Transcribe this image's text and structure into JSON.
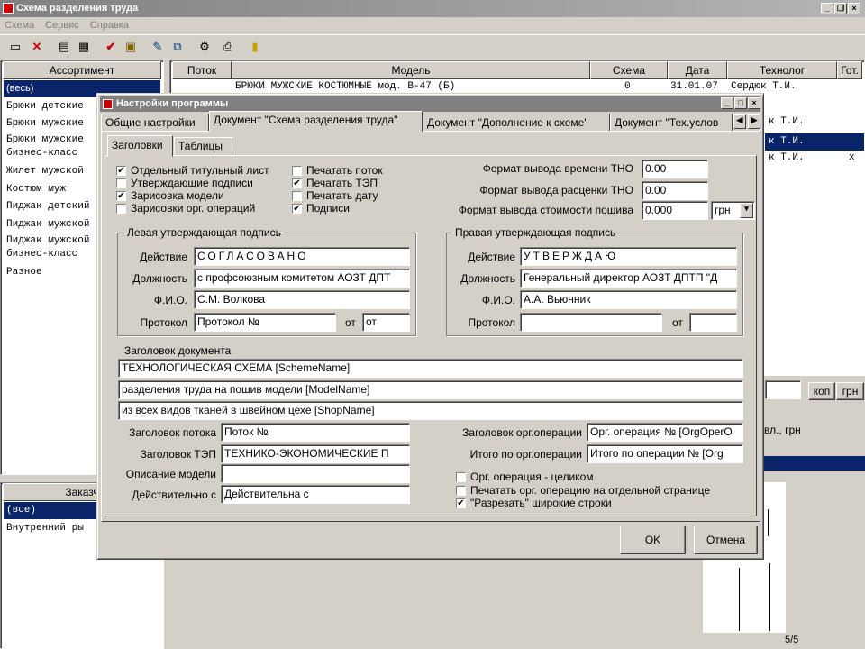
{
  "app": {
    "title": "Схема разделения труда"
  },
  "menu": [
    "Схема",
    "Сервис",
    "Справка"
  ],
  "assortment": {
    "header": "Ассортимент",
    "items": [
      "(весь)",
      "Брюки детские",
      "Брюки мужские",
      "Брюки мужские",
      "бизнес-класс",
      "Жилет мужской",
      "Костюм муж",
      "Пиджак детский",
      "Пиджак мужской",
      "Пиджак мужской",
      "бизнес-класс",
      "Разное"
    ]
  },
  "grid": {
    "headers": [
      "Поток",
      "Модель",
      "Схема",
      "Дата",
      "Технолог",
      "Гот."
    ],
    "row1": {
      "model": "БРЮКИ МУЖСКИЕ КОСТЮМНЫЕ мод. B-47 (Б)",
      "scheme": "0",
      "date": "31.01.07",
      "tech": "Сердюк Т.И."
    },
    "partial_tech": [
      "к Т.И.",
      "к Т.И.",
      "к Т.И."
    ],
    "done_mark": "x"
  },
  "customers": {
    "header": "Заказч",
    "items": [
      "(все)",
      "Внутренний ры"
    ]
  },
  "right_panel": {
    "kop": "коп",
    "grn": "грн",
    "partial_text": "вл., грн",
    "status": "5/5"
  },
  "dialog": {
    "title": "Настройки программы",
    "tabs": [
      "Общие настройки",
      "Документ \"Схема разделения труда\"",
      "Документ \"Дополнение к схеме\"",
      "Документ \"Тех.услов"
    ],
    "subtabs": [
      "Заголовки",
      "Таблицы"
    ],
    "checks_left": [
      {
        "label": "Отдельный титульный лист",
        "checked": true
      },
      {
        "label": "Утверждающие подписи",
        "checked": false
      },
      {
        "label": "Зарисовка модели",
        "checked": true
      },
      {
        "label": "Зарисовки орг. операций",
        "checked": false
      }
    ],
    "checks_mid": [
      {
        "label": "Печатать поток",
        "checked": false
      },
      {
        "label": "Печатать ТЭП",
        "checked": true
      },
      {
        "label": "Печатать дату",
        "checked": false
      },
      {
        "label": "Подписи",
        "checked": true
      }
    ],
    "formats": {
      "time_label": "Формат вывода времени ТНО",
      "time_value": "0.00",
      "price_label": "Формат вывода расценки ТНО",
      "price_value": "0.00",
      "cost_label": "Формат вывода стоимости пошива",
      "cost_value": "0.000",
      "currency": "грн"
    },
    "left_sign": {
      "title": "Левая утверждающая подпись",
      "action_label": "Действие",
      "action": "СОГЛАСОВАНО",
      "position_label": "Должность",
      "position": "с профсоюзным комитетом АОЗТ ДПТ",
      "name_label": "Ф.И.О.",
      "name": "С.М. Волкова",
      "protocol_label": "Протокол",
      "protocol": "Протокол №",
      "from_label": "от",
      "from": "от"
    },
    "right_sign": {
      "title": "Правая утверждающая подпись",
      "action_label": "Действие",
      "action": "УТВЕРЖДАЮ",
      "position_label": "Должность",
      "position": "Генеральный директор АОЗТ ДПТП \"Д",
      "name_label": "Ф.И.О.",
      "name": "А.А. Вьюнник",
      "protocol_label": "Протокол",
      "protocol": "",
      "from_label": "от",
      "from": ""
    },
    "doc_header": {
      "title": "Заголовок документа",
      "lines": [
        "ТЕХНОЛОГИЧЕСКАЯ СХЕМА [SchemeName]",
        "разделения труда на пошив модели [ModelName]",
        "из всех видов тканей в швейном цехе [ShopName]"
      ]
    },
    "flow_header_label": "Заголовок потока",
    "flow_header": "Поток №",
    "tep_header_label": "Заголовок ТЭП",
    "tep_header": "ТЕХНИКО-ЭКОНОМИЧЕСКИЕ П",
    "model_desc_label": "Описание модели",
    "model_desc": "",
    "valid_from_label": "Действительно с",
    "valid_from": "Действительна с",
    "org_op_header_label": "Заголовок орг.операции",
    "org_op_header": "Орг. операция № [OrgOperO",
    "org_op_total_label": "Итого по орг.операции",
    "org_op_total": "Итого по операции № [Org",
    "checks_bottom": [
      {
        "label": "Орг. операция - целиком",
        "checked": false
      },
      {
        "label": "Печатать орг. операцию на отдельной странице",
        "checked": false
      },
      {
        "label": "\"Разрезать\" широкие строки",
        "checked": true
      }
    ],
    "ok": "OK",
    "cancel": "Отмена"
  }
}
